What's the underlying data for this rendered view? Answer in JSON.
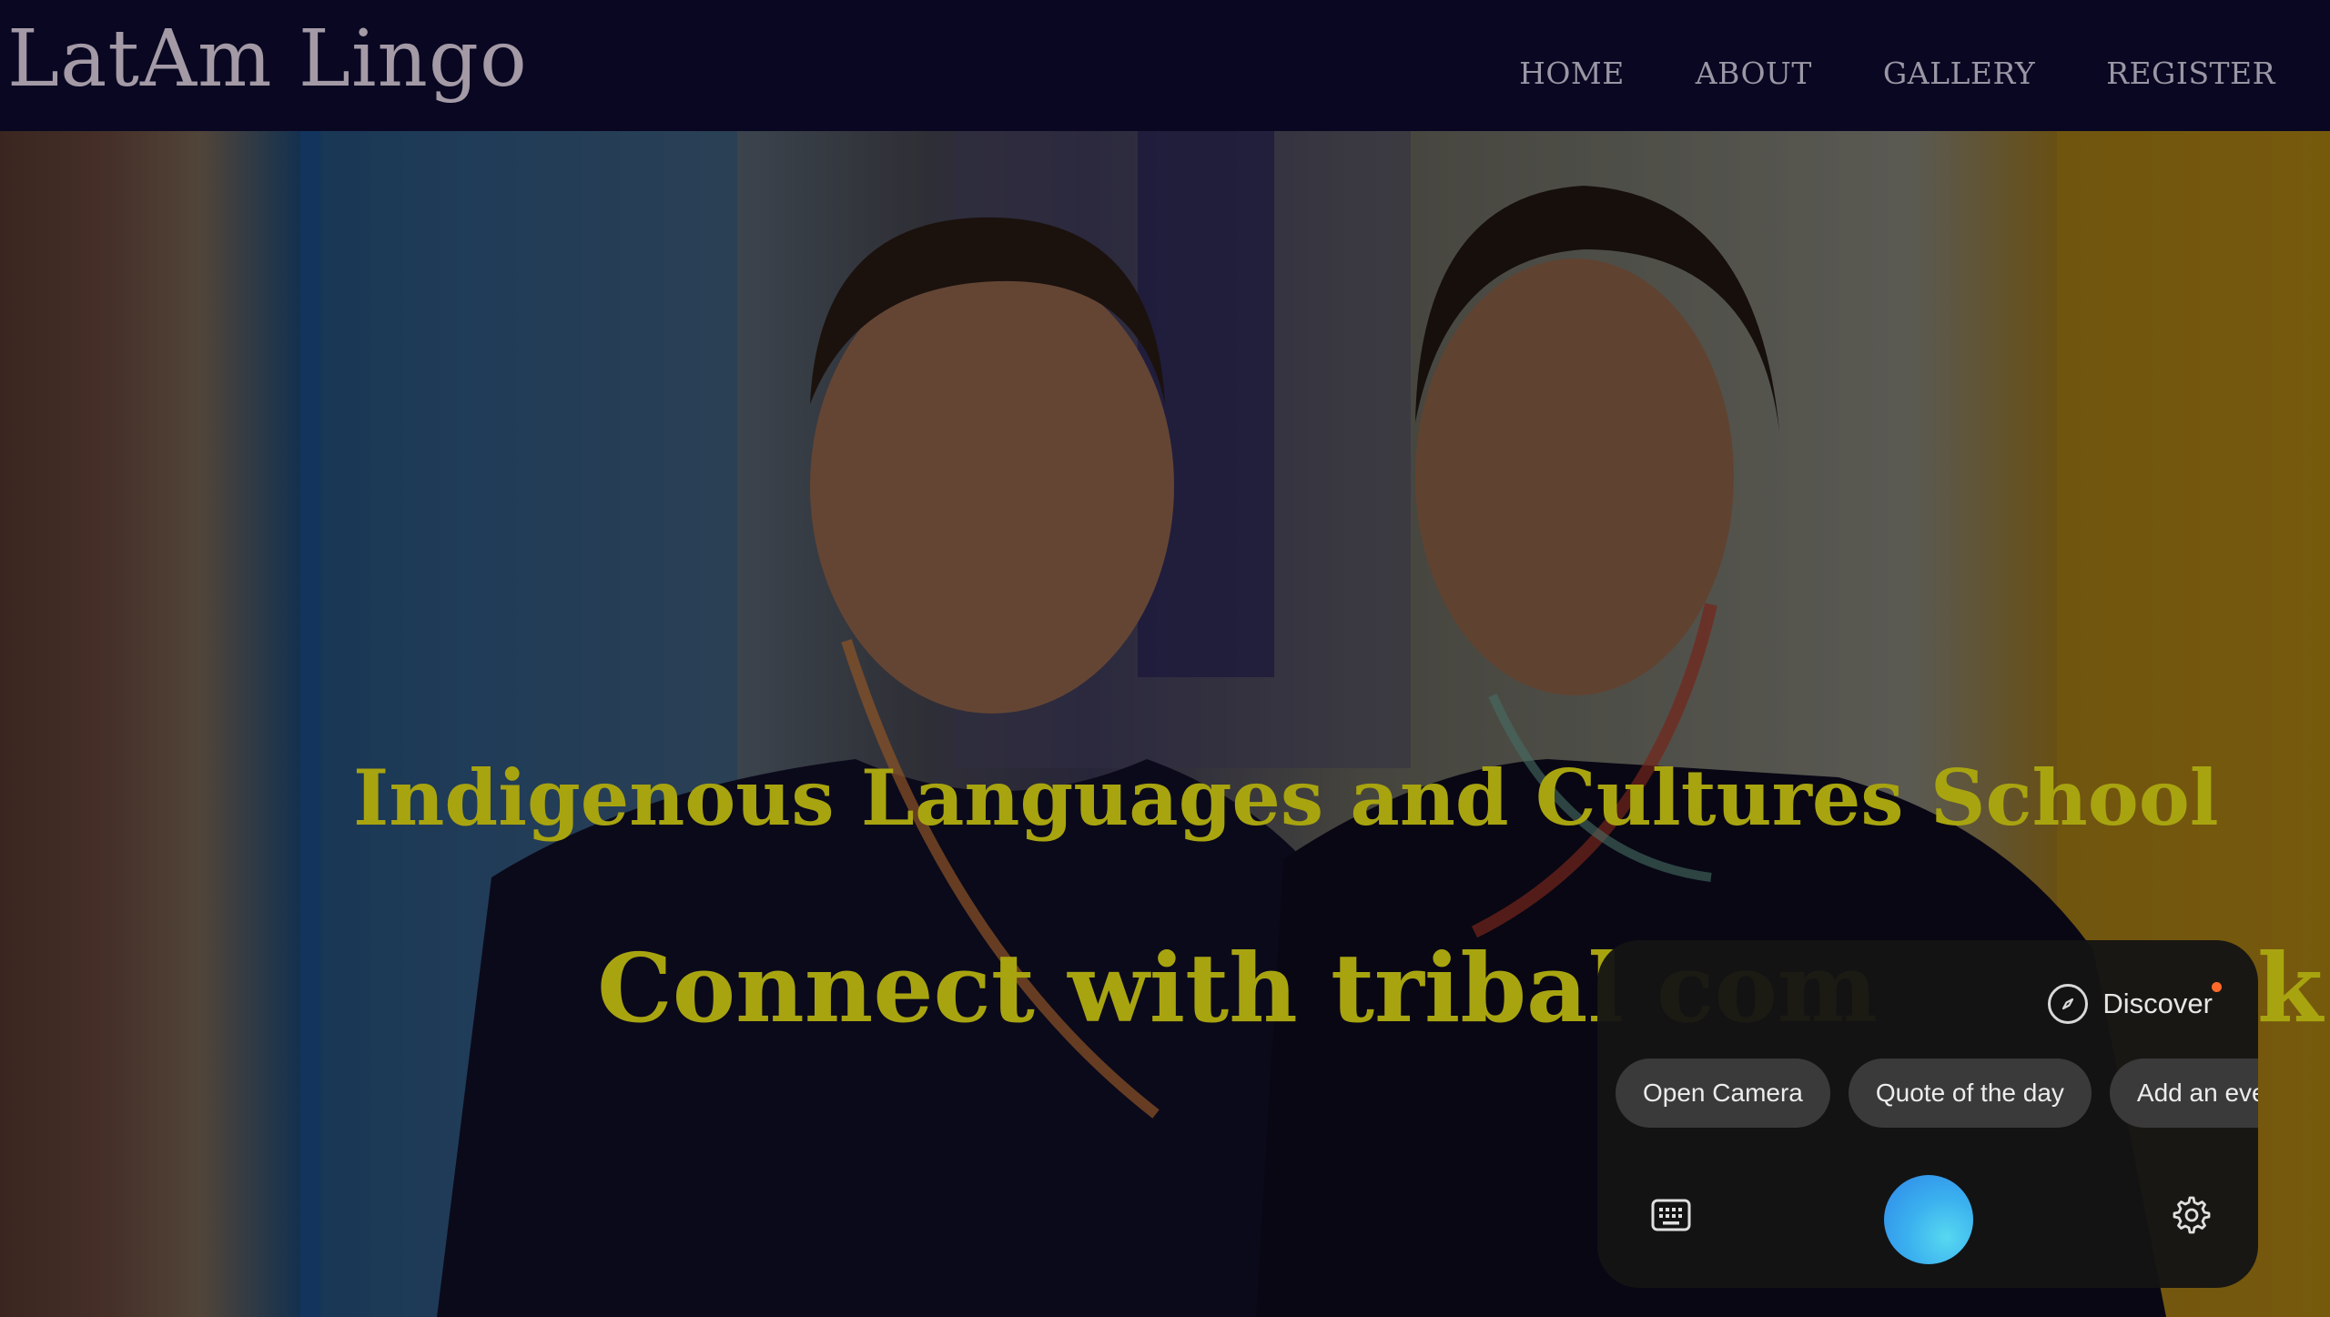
{
  "header": {
    "brand": "LatAm Lingo",
    "nav": [
      "HOME",
      "ABOUT",
      "GALLERY",
      "REGISTER"
    ]
  },
  "hero": {
    "title": "Indigenous Languages and Cultures School",
    "subtitle": "Connect with tribal com",
    "subtitle_tail": "k t",
    "title_color": "#a8a410"
  },
  "assistant": {
    "discover_label": "Discover",
    "chips": [
      "Open Camera",
      "Quote of the day",
      "Add an eve"
    ],
    "icons": [
      "compass-icon",
      "keyboard-icon",
      "assistant-orb",
      "gear-icon"
    ],
    "accent": "#3ab0ef",
    "notification_color": "#ff6a2a"
  }
}
